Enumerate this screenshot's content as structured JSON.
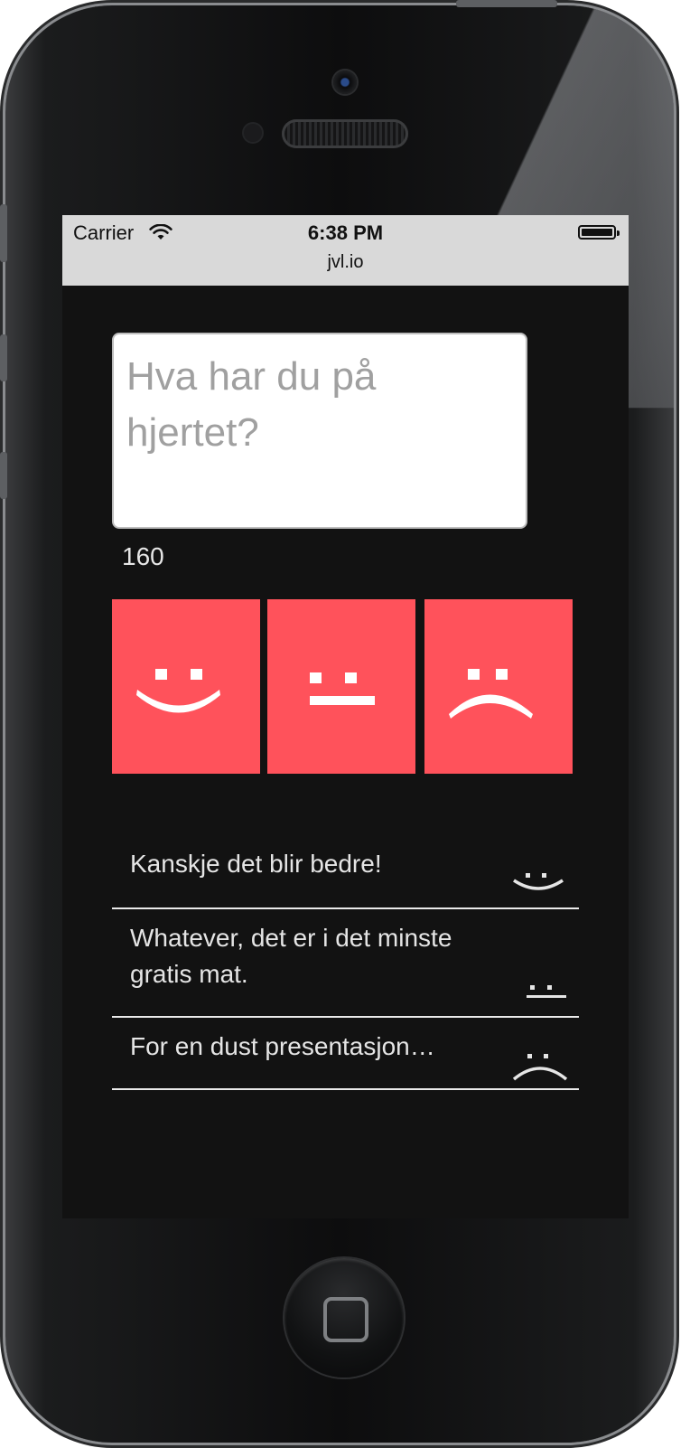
{
  "status_bar": {
    "carrier": "Carrier",
    "time": "6:38 PM",
    "url": "jvl.io",
    "icons": [
      "wifi-icon",
      "battery-icon"
    ]
  },
  "composer": {
    "placeholder": "Hva har du på hjertet?",
    "value": "",
    "char_count": "160"
  },
  "mood_buttons": [
    {
      "mood": "happy",
      "icon": "happy-face-icon"
    },
    {
      "mood": "neutral",
      "icon": "neutral-face-icon"
    },
    {
      "mood": "sad",
      "icon": "sad-face-icon"
    }
  ],
  "feed": [
    {
      "text": "Kanskje det blir bedre!",
      "mood": "happy",
      "icon": "happy-face-icon"
    },
    {
      "text": "Whatever, det er i det minste gratis mat.",
      "mood": "neutral",
      "icon": "neutral-face-icon"
    },
    {
      "text": "For en dust presentasjon…",
      "mood": "sad",
      "icon": "sad-face-icon"
    }
  ],
  "colors": {
    "accent": "#ff525b",
    "screen_background": "#121212",
    "status_bar": "#d9d9d9",
    "text_light": "#e5e5e5"
  }
}
